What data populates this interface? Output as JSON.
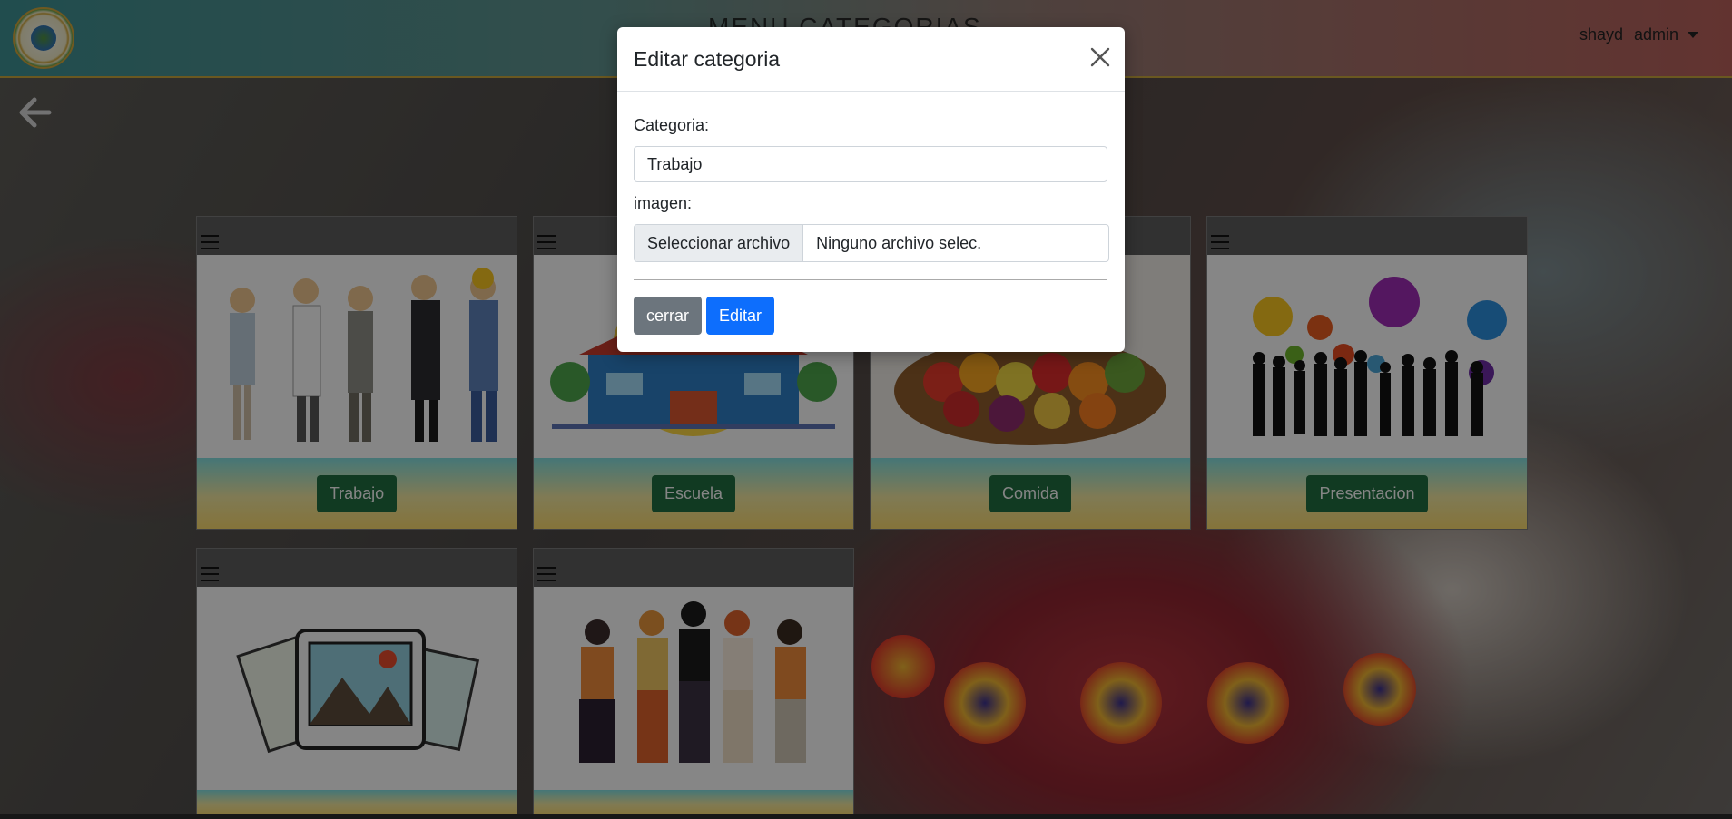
{
  "navbar": {
    "title": "MENU CATEGORIAS",
    "user": "shayd",
    "role_menu": "admin"
  },
  "cards": [
    {
      "label": "Trabajo"
    },
    {
      "label": "Escuela"
    },
    {
      "label": "Comida"
    },
    {
      "label": "Presentacion"
    }
  ],
  "modal": {
    "title": "Editar categoria",
    "category_label": "Categoria:",
    "category_value": "Trabajo",
    "image_label": "imagen:",
    "file_button": "Seleccionar archivo",
    "file_status": "Ninguno archivo selec.",
    "close_label": "cerrar",
    "edit_label": "Editar"
  },
  "colors": {
    "primary": "#0d6efd",
    "secondary": "#6c757d",
    "category_button": "#1f6b3e"
  },
  "icons": [
    "logo",
    "arrow-left-icon",
    "hamburger-icon",
    "close-icon",
    "caret-down-icon"
  ]
}
